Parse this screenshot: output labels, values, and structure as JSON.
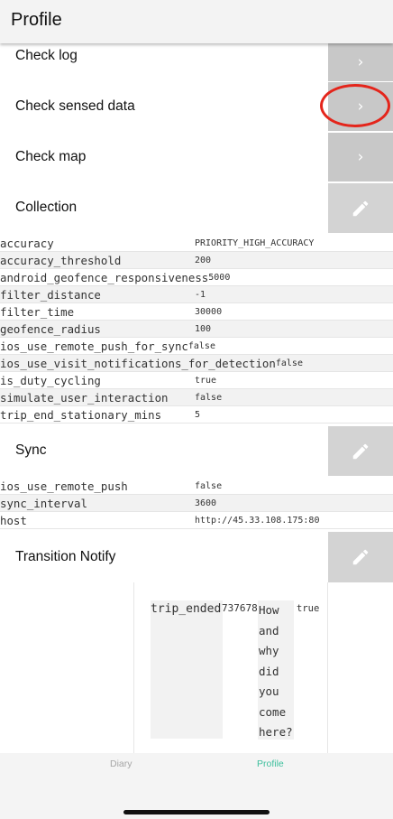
{
  "header": {
    "title": "Profile"
  },
  "rows": {
    "check_log": "Check log",
    "check_sensed_data": "Check sensed data",
    "check_map": "Check map",
    "collection": "Collection",
    "sync": "Sync",
    "transition_notify": "Transition Notify"
  },
  "icons": {
    "chevron": "chevron-right-icon",
    "edit": "pencil-icon"
  },
  "collection": [
    {
      "key": "accuracy",
      "value": "PRIORITY_HIGH_ACCURACY"
    },
    {
      "key": "accuracy_threshold",
      "value": "200"
    },
    {
      "key": "android_geofence_responsiveness",
      "value": "5000"
    },
    {
      "key": "filter_distance",
      "value": "-1"
    },
    {
      "key": "filter_time",
      "value": "30000"
    },
    {
      "key": "geofence_radius",
      "value": "100"
    },
    {
      "key": "ios_use_remote_push_for_sync",
      "value": "false"
    },
    {
      "key": "ios_use_visit_notifications_for_detection",
      "value": "false"
    },
    {
      "key": "is_duty_cycling",
      "value": "true"
    },
    {
      "key": "simulate_user_interaction",
      "value": "false"
    },
    {
      "key": "trip_end_stationary_mins",
      "value": "5"
    }
  ],
  "sync": [
    {
      "key": "ios_use_remote_push",
      "value": "false"
    },
    {
      "key": "sync_interval",
      "value": "3600"
    },
    {
      "key": "host",
      "value": "http://45.33.108.175:80"
    }
  ],
  "notify": {
    "name": "trip_ended",
    "id": "737678",
    "text_words": [
      "How",
      "and",
      "why",
      "did",
      "you",
      "come",
      "here?"
    ],
    "flag": "true"
  },
  "tabs": {
    "diary": "Diary",
    "profile": "Profile"
  },
  "colors": {
    "accent": "#3dbf9d",
    "highlight_circle": "#e4251b",
    "button_gray": "#c8c8c8"
  }
}
